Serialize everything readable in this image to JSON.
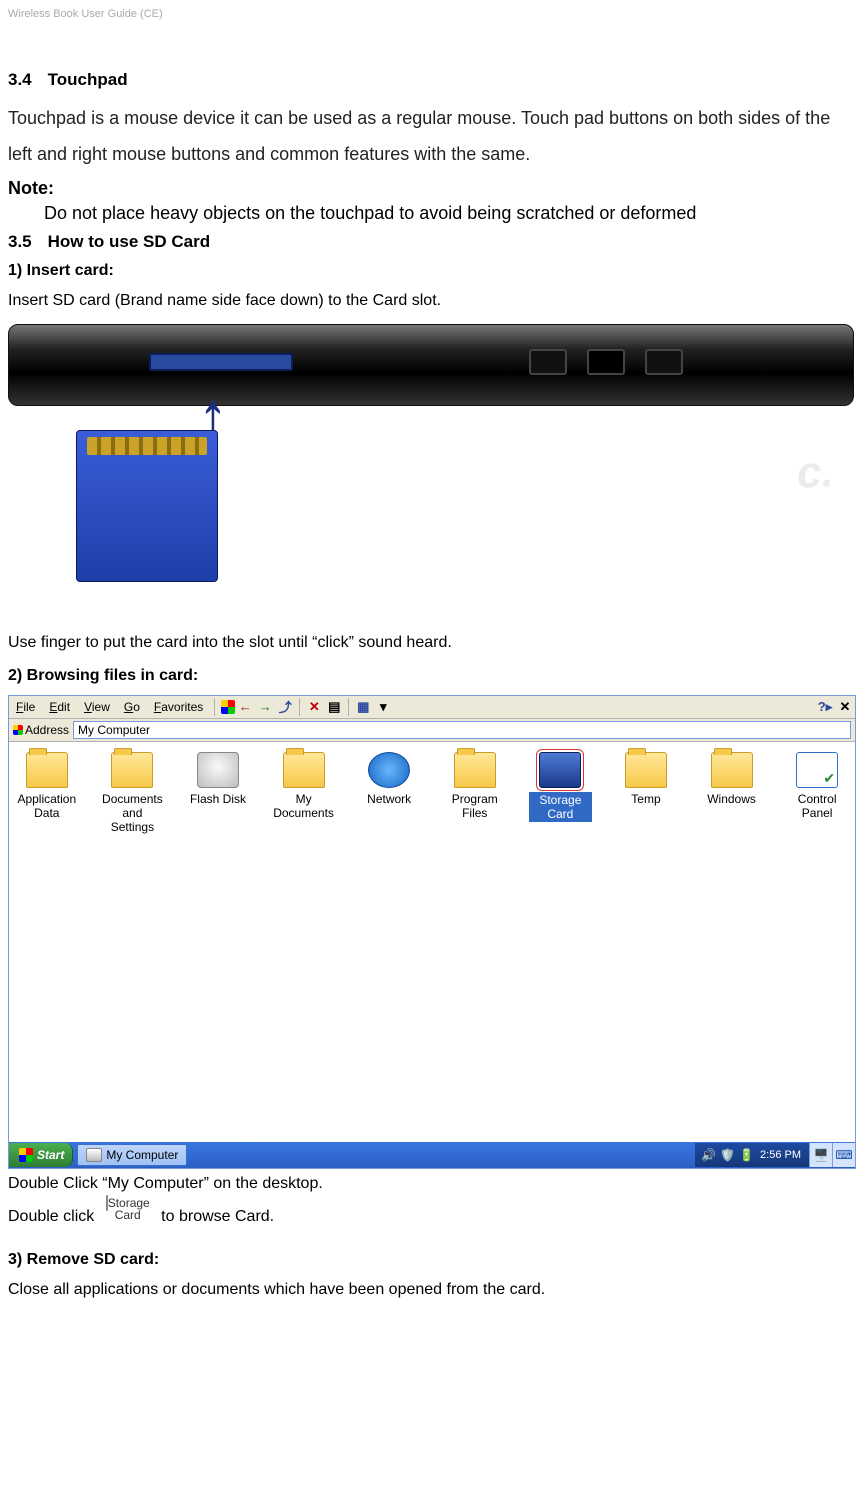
{
  "header": "Wireless Book User Guide (CE)",
  "section34": {
    "num": "3.4",
    "title": "Touchpad"
  },
  "touchpad_text": "Touchpad is a mouse device it can be used as a regular mouse. Touch pad buttons on both sides of the left and right mouse buttons and common features with the same.",
  "note_label": "Note:",
  "note_body": "Do not place heavy objects on the touchpad to avoid being scratched or deformed",
  "section35": {
    "num": "3.5",
    "title": "How to use SD Card"
  },
  "insert_card_h": "1) Insert card:",
  "insert_card_t": "Insert SD card (Brand name side face down) to the Card slot.",
  "after_insert": "Use finger to put the card into the slot until “click” sound heard.",
  "browsing_h": "2) Browsing files in card:",
  "explorer": {
    "menus": [
      "File",
      "Edit",
      "View",
      "Go",
      "Favorites"
    ],
    "back_icon": "←",
    "fwd_icon": "→",
    "up_icon": "⤴",
    "del_icon": "✕",
    "props_icon": "▤",
    "views_icon": "▦",
    "help_icon": "?",
    "close_icon": "✕",
    "address_label": "Address",
    "address_value": "My Computer",
    "drives": [
      {
        "name": "Application Data",
        "type": "folder"
      },
      {
        "name": "Documents and Settings",
        "type": "folder"
      },
      {
        "name": "Flash Disk",
        "type": "disk"
      },
      {
        "name": "My Documents",
        "type": "folder"
      },
      {
        "name": "Network",
        "type": "net"
      },
      {
        "name": "Program Files",
        "type": "folder"
      },
      {
        "name": "Storage Card",
        "type": "card",
        "selected": true
      },
      {
        "name": "Temp",
        "type": "folder"
      },
      {
        "name": "Windows",
        "type": "folder"
      },
      {
        "name": "Control Panel",
        "type": "cpanel"
      }
    ],
    "start_label": "Start",
    "task_item": "My Computer",
    "clock": "2:56 PM"
  },
  "dc_mycomp": "Double Click “My Computer” on the desktop.",
  "dc_line_prefix": "Double click",
  "dc_line_suffix": " to browse Card.",
  "sc_label": "Storage Card",
  "remove_h": "3) Remove SD card:",
  "remove_t": "Close all applications or documents which have been opened from the card."
}
